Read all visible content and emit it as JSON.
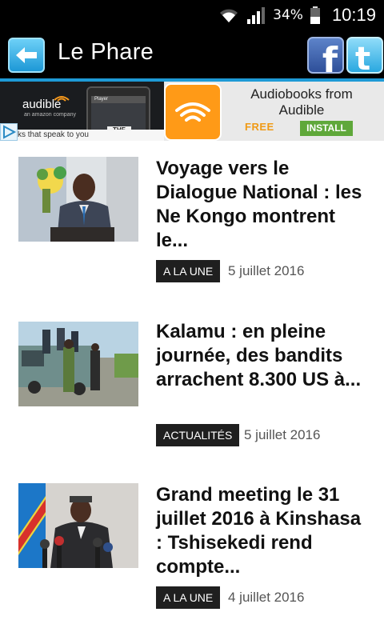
{
  "status_bar": {
    "battery": "34%",
    "time": "10:19",
    "icons": [
      "wifi-icon",
      "signal-icon",
      "battery-icon"
    ]
  },
  "app_bar": {
    "title": "Le Phare",
    "back_icon": "back-arrow-icon",
    "social": [
      "facebook-icon",
      "twitter-icon"
    ],
    "accent_color": "#1e9ad6"
  },
  "ad": {
    "brand": "audible",
    "brand_sub": "an amazon company",
    "phone_label": "Player",
    "book_cover": "THE GIRL",
    "tagline": "ks that speak to you",
    "headline": "Audiobooks from Audible",
    "free_label": "FREE",
    "install_label": "INSTALL",
    "colors": {
      "free": "#f09a15",
      "install": "#5fa83a",
      "icon": "#ff9a17"
    }
  },
  "articles": [
    {
      "title": "Voyage vers le Dialogue National : les Ne Kongo montrent le...",
      "category": "A LA UNE",
      "date": "5 juillet 2016",
      "thumb": "portrait-man-in-suit"
    },
    {
      "title": "Kalamu : en pleine journée, des bandits arrachent 8.300 US à...",
      "category": "ACTUALITÉS",
      "date": "5 juillet 2016",
      "thumb": "police-truck-street"
    },
    {
      "title": "Grand meeting le 31 juillet 2016 à Kinshasa : Tshisekedi rend compte...",
      "category": "A LA UNE",
      "date": "4 juillet 2016",
      "thumb": "speaker-with-flag-microphones"
    }
  ]
}
